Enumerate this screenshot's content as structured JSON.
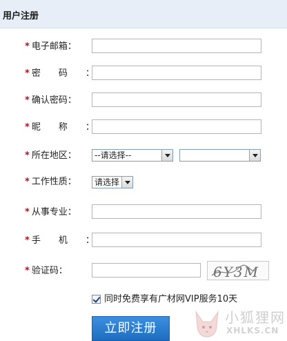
{
  "header": {
    "title": "用户注册"
  },
  "required_mark": "*",
  "fields": {
    "email": {
      "label": "电子邮箱：",
      "value": ""
    },
    "password": {
      "label": "密码：",
      "value": ""
    },
    "confirm_password": {
      "label": "确认密码：",
      "value": ""
    },
    "nickname": {
      "label": "昵称：",
      "value": ""
    },
    "region": {
      "label": "所在地区：",
      "province": "--请选择--",
      "city": ""
    },
    "job_nature": {
      "label": "工作性质：",
      "selected": "请选择"
    },
    "profession": {
      "label": "从事专业：",
      "value": ""
    },
    "mobile": {
      "label": "手机：",
      "value": ""
    },
    "captcha": {
      "label": "验证码：",
      "value": "",
      "image_text": "6Y3M"
    }
  },
  "agreement": {
    "checked": true,
    "label": "同时免费享有广材网VIP服务10天"
  },
  "submit": {
    "label": "立即注册"
  },
  "watermark": {
    "cn": "小狐狸网",
    "en": "XHLKS.CN"
  }
}
